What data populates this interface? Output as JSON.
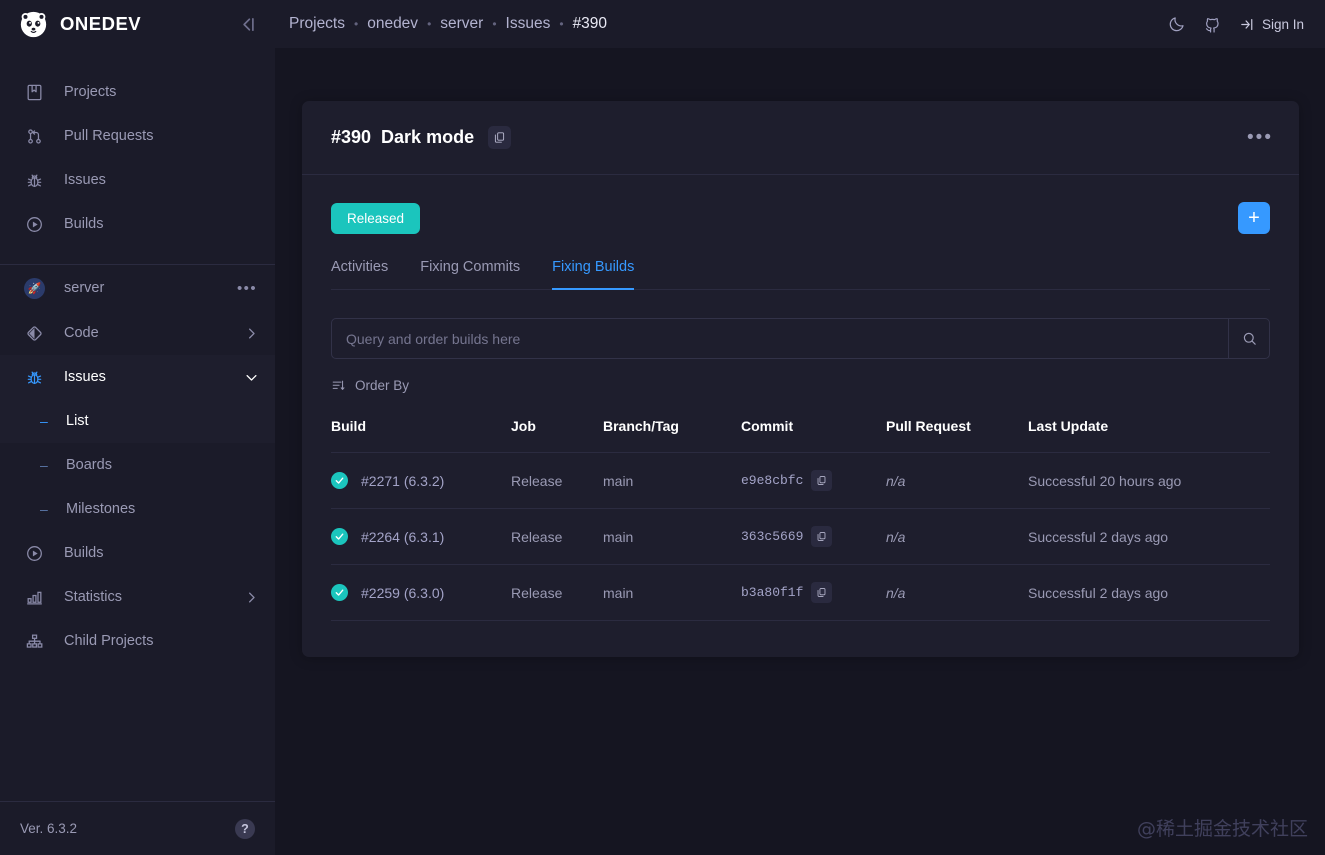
{
  "brand": {
    "name": "ONEDEV",
    "logo_icon": "panda-logo-icon",
    "collapse_icon": "collapse-sidebar-icon"
  },
  "sidebar": {
    "global_items": [
      {
        "label": "Projects",
        "icon": "projects-icon"
      },
      {
        "label": "Pull Requests",
        "icon": "pull-request-icon"
      },
      {
        "label": "Issues",
        "icon": "bug-icon"
      },
      {
        "label": "Builds",
        "icon": "play-circle-icon"
      }
    ],
    "project": {
      "name": "server",
      "avatar_icon": "rocket-icon",
      "menu_icon": "ellipsis-icon"
    },
    "project_items": [
      {
        "label": "Code",
        "icon": "code-icon",
        "chevron": "chevron-right-icon",
        "active": false
      },
      {
        "label": "Issues",
        "icon": "bug-icon",
        "chevron": "chevron-down-icon",
        "active": true
      }
    ],
    "issue_subitems": [
      {
        "label": "List",
        "active": true
      },
      {
        "label": "Boards",
        "active": false
      },
      {
        "label": "Milestones",
        "active": false
      }
    ],
    "tail_items": [
      {
        "label": "Builds",
        "icon": "play-circle-icon",
        "chevron": ""
      },
      {
        "label": "Statistics",
        "icon": "bar-chart-icon",
        "chevron": "chevron-right-icon"
      },
      {
        "label": "Child Projects",
        "icon": "sitemap-icon",
        "chevron": ""
      }
    ],
    "footer": {
      "version": "Ver. 6.3.2",
      "help_label": "?",
      "help_icon": "help-icon"
    }
  },
  "topbar": {
    "breadcrumb": [
      {
        "label": "Projects",
        "last": false
      },
      {
        "label": "onedev",
        "last": false
      },
      {
        "label": "server",
        "last": false
      },
      {
        "label": "Issues",
        "last": false
      },
      {
        "label": "#390",
        "last": true
      }
    ],
    "separator": "•",
    "dark_mode_icon": "moon-icon",
    "github_icon": "github-icon",
    "sign_in_label": "Sign In",
    "sign_in_icon": "sign-in-icon"
  },
  "issue": {
    "number": "#390",
    "title": "Dark mode",
    "copy_icon": "copy-icon",
    "menu_icon": "ellipsis-icon",
    "status_badge": "Released",
    "add_button_label": "+"
  },
  "tabs": [
    {
      "label": "Activities",
      "active": false
    },
    {
      "label": "Fixing Commits",
      "active": false
    },
    {
      "label": "Fixing Builds",
      "active": true
    }
  ],
  "search": {
    "placeholder": "Query and order builds here",
    "value": "",
    "search_icon": "search-icon"
  },
  "order_by": {
    "label": "Order By",
    "icon": "sort-icon"
  },
  "table": {
    "columns": [
      "Build",
      "Job",
      "Branch/Tag",
      "Commit",
      "Pull Request",
      "Last Update"
    ],
    "rows": [
      {
        "status_icon": "check-circle-icon",
        "build": "#2271 (6.3.2)",
        "job": "Release",
        "branch": "main",
        "commit": "e9e8cbfc",
        "commit_copy_icon": "copy-icon",
        "pull_request": "n/a",
        "last_update": "Successful 20 hours ago"
      },
      {
        "status_icon": "check-circle-icon",
        "build": "#2264 (6.3.1)",
        "job": "Release",
        "branch": "main",
        "commit": "363c5669",
        "commit_copy_icon": "copy-icon",
        "pull_request": "n/a",
        "last_update": "Successful 2 days ago"
      },
      {
        "status_icon": "check-circle-icon",
        "build": "#2259 (6.3.0)",
        "job": "Release",
        "branch": "main",
        "commit": "b3a80f1f",
        "commit_copy_icon": "copy-icon",
        "pull_request": "n/a",
        "last_update": "Successful 2 days ago"
      }
    ]
  },
  "watermark": "@稀土掘金技术社区",
  "colors": {
    "page_bg": "#151521",
    "sidebar_bg": "#1b1b29",
    "card_bg": "#1e1e2d",
    "accent_blue": "#3699ff",
    "accent_teal": "#1bc5bd",
    "border": "#2b2b40"
  }
}
